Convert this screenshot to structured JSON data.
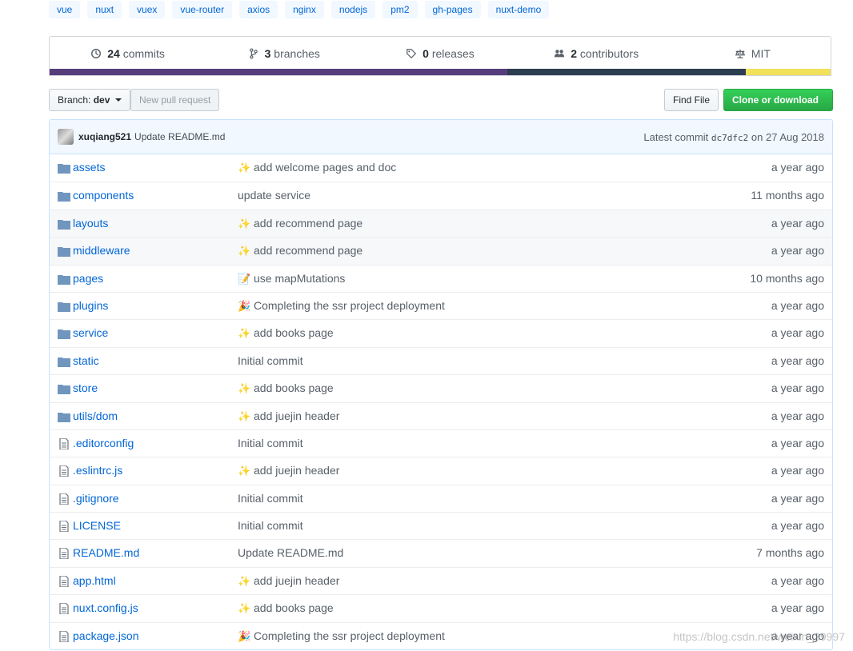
{
  "topics": [
    "vue",
    "nuxt",
    "vuex",
    "vue-router",
    "axios",
    "nginx",
    "nodejs",
    "pm2",
    "gh-pages",
    "nuxt-demo"
  ],
  "summary": {
    "commits_count": "24",
    "commits_label": "commits",
    "branches_count": "3",
    "branches_label": "branches",
    "releases_count": "0",
    "releases_label": "releases",
    "contributors_count": "2",
    "contributors_label": "contributors",
    "license": "MIT"
  },
  "language_bar": [
    {
      "color": "#563d7c",
      "percent": 58.6
    },
    {
      "color": "#2c3e50",
      "percent": 30.5
    },
    {
      "color": "#f1e05a",
      "percent": 10.9
    }
  ],
  "toolbar": {
    "branch_label": "Branch:",
    "branch_value": "dev",
    "new_pr": "New pull request",
    "find_file": "Find File",
    "clone": "Clone or download"
  },
  "commit": {
    "author": "xuqiang521",
    "message": "Update README.md",
    "latest_label": "Latest commit",
    "sha": "dc7dfc2",
    "date_text": "on 27 Aug 2018"
  },
  "files": [
    {
      "name": "assets",
      "type": "dir",
      "emoji": "✨",
      "message": "add welcome pages and doc",
      "age": "a year ago"
    },
    {
      "name": "components",
      "type": "dir",
      "emoji": "",
      "message": "update service",
      "age": "11 months ago"
    },
    {
      "name": "layouts",
      "type": "dir",
      "emoji": "✨",
      "message": "add recommend page",
      "age": "a year ago"
    },
    {
      "name": "middleware",
      "type": "dir",
      "emoji": "✨",
      "message": "add recommend page",
      "age": "a year ago"
    },
    {
      "name": "pages",
      "type": "dir",
      "emoji": "📝",
      "message": "use mapMutations",
      "age": "10 months ago"
    },
    {
      "name": "plugins",
      "type": "dir",
      "emoji": "🎉",
      "message": "Completing the ssr project deployment",
      "age": "a year ago"
    },
    {
      "name": "service",
      "type": "dir",
      "emoji": "✨",
      "message": "add books page",
      "age": "a year ago"
    },
    {
      "name": "static",
      "type": "dir",
      "emoji": "",
      "message": "Initial commit",
      "age": "a year ago"
    },
    {
      "name": "store",
      "type": "dir",
      "emoji": "✨",
      "message": "add books page",
      "age": "a year ago"
    },
    {
      "name": "utils/dom",
      "type": "dir",
      "emoji": "✨",
      "message": "add juejin header",
      "age": "a year ago"
    },
    {
      "name": ".editorconfig",
      "type": "file",
      "emoji": "",
      "message": "Initial commit",
      "age": "a year ago"
    },
    {
      "name": ".eslintrc.js",
      "type": "file",
      "emoji": "✨",
      "message": "add juejin header",
      "age": "a year ago"
    },
    {
      "name": ".gitignore",
      "type": "file",
      "emoji": "",
      "message": "Initial commit",
      "age": "a year ago"
    },
    {
      "name": "LICENSE",
      "type": "file",
      "emoji": "",
      "message": "Initial commit",
      "age": "a year ago"
    },
    {
      "name": "README.md",
      "type": "file",
      "emoji": "",
      "message": "Update README.md",
      "age": "7 months ago"
    },
    {
      "name": "app.html",
      "type": "file",
      "emoji": "✨",
      "message": "add juejin header",
      "age": "a year ago"
    },
    {
      "name": "nuxt.config.js",
      "type": "file",
      "emoji": "✨",
      "message": "add books page",
      "age": "a year ago"
    },
    {
      "name": "package.json",
      "type": "file",
      "emoji": "🎉",
      "message": "Completing the ssr project deployment",
      "age": "a year ago"
    }
  ],
  "watermark": "https://blog.csdn.net/weixin_39997"
}
